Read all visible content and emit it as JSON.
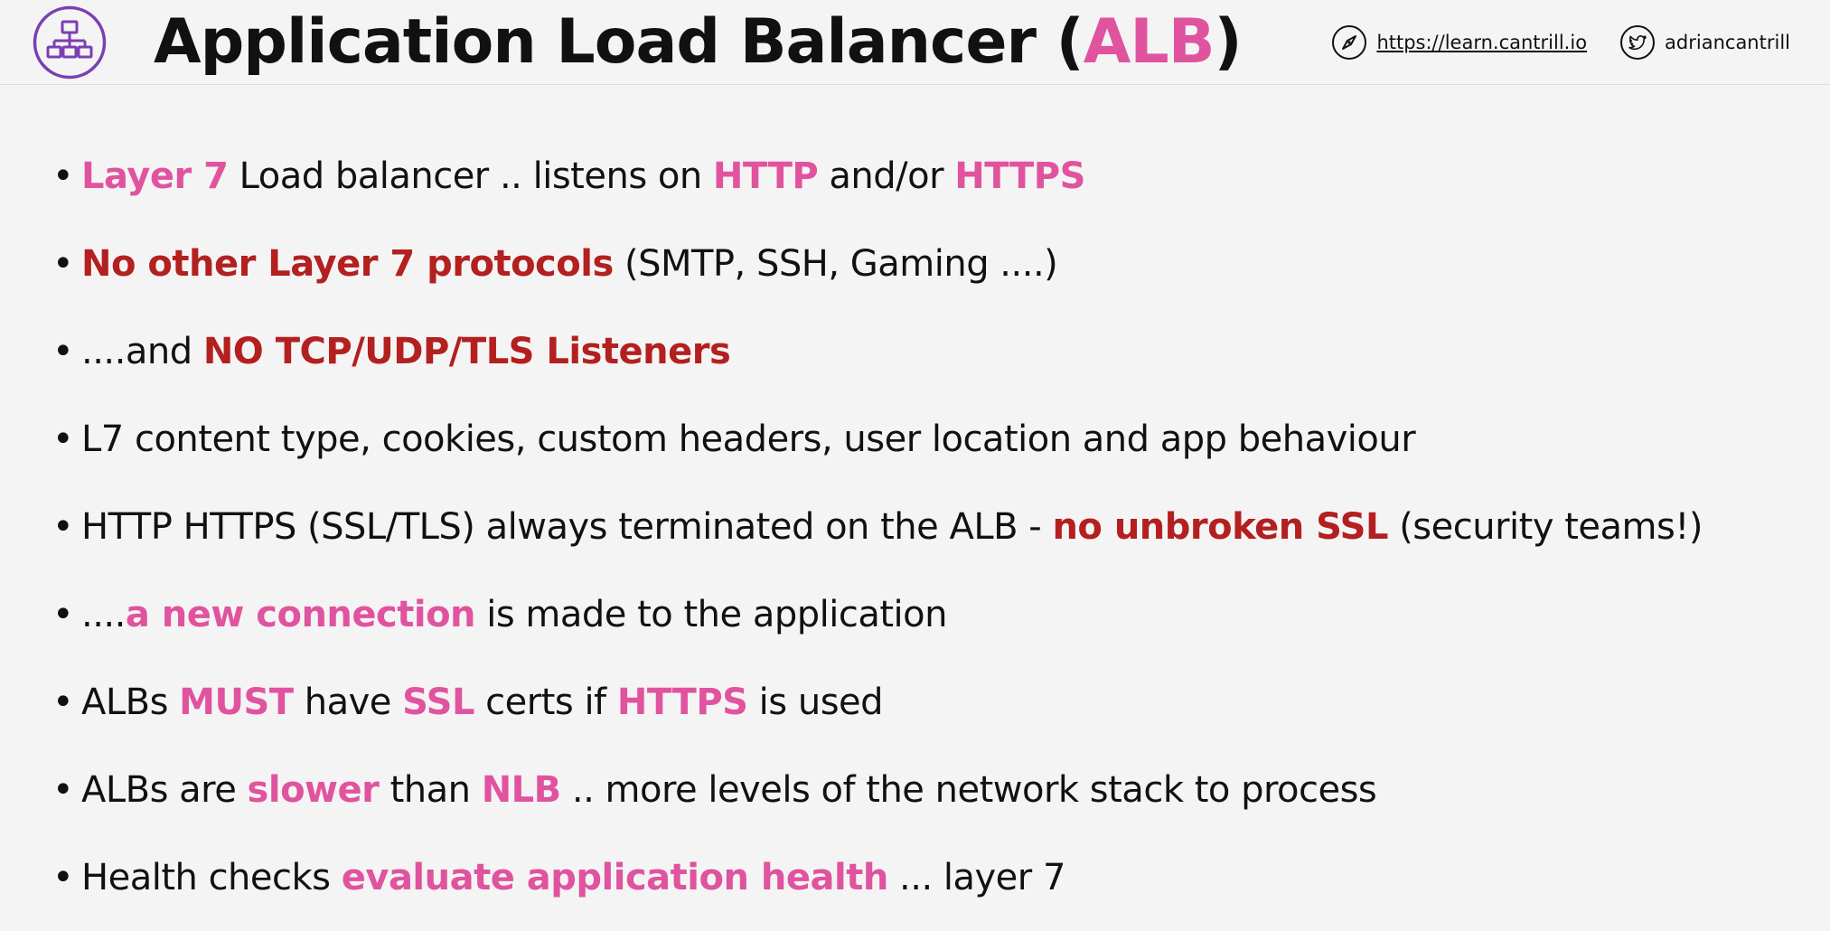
{
  "header": {
    "logo_icon": "load-balancer-icon",
    "title_prefix": "Application Load Balancer (",
    "title_accent": "ALB",
    "title_suffix": ")",
    "site_icon": "compass-icon",
    "site_url": "https://learn.cantrill.io",
    "twitter_icon": "twitter-icon",
    "twitter_handle": "adriancantrill"
  },
  "colors": {
    "accent_pink": "#e0539f",
    "accent_red": "#b3201f",
    "logo_purple": "#7b3fb3",
    "background": "#f4f4f4"
  },
  "bullet_glyph": "•",
  "bullets": [
    [
      {
        "text": "Layer 7",
        "style": "pk"
      },
      {
        "text": " Load balancer .. listens on ",
        "style": "n"
      },
      {
        "text": "HTTP",
        "style": "pk"
      },
      {
        "text": " and/or ",
        "style": "n"
      },
      {
        "text": "HTTPS",
        "style": "pk"
      }
    ],
    [
      {
        "text": "No other Layer 7 protocols",
        "style": "rd"
      },
      {
        "text": " (SMTP, SSH, Gaming ....)",
        "style": "n"
      }
    ],
    [
      {
        "text": "....and ",
        "style": "n"
      },
      {
        "text": "NO TCP/UDP/TLS Listeners",
        "style": "rd"
      }
    ],
    [
      {
        "text": "L7 content type, cookies, custom headers, user location and app behaviour",
        "style": "n"
      }
    ],
    [
      {
        "text": "HTTP HTTPS (SSL/TLS) always terminated on the ALB - ",
        "style": "n"
      },
      {
        "text": "no unbroken SSL",
        "style": "rd"
      },
      {
        "text": " (security teams!)",
        "style": "n"
      }
    ],
    [
      {
        "text": "....",
        "style": "n"
      },
      {
        "text": "a new connection",
        "style": "pk"
      },
      {
        "text": " is made to the application",
        "style": "n"
      }
    ],
    [
      {
        "text": "ALBs ",
        "style": "n"
      },
      {
        "text": "MUST",
        "style": "pk"
      },
      {
        "text": " have ",
        "style": "n"
      },
      {
        "text": "SSL",
        "style": "pk"
      },
      {
        "text": " certs if ",
        "style": "n"
      },
      {
        "text": "HTTPS",
        "style": "pk"
      },
      {
        "text": " is used",
        "style": "n"
      }
    ],
    [
      {
        "text": "ALBs are ",
        "style": "n"
      },
      {
        "text": "slower",
        "style": "pk"
      },
      {
        "text": " than ",
        "style": "n"
      },
      {
        "text": "NLB",
        "style": "pk"
      },
      {
        "text": " .. more levels of the network stack to process",
        "style": "n"
      }
    ],
    [
      {
        "text": "Health checks ",
        "style": "n"
      },
      {
        "text": "evaluate application health",
        "style": "pk"
      },
      {
        "text": " ... layer 7",
        "style": "n"
      }
    ]
  ]
}
